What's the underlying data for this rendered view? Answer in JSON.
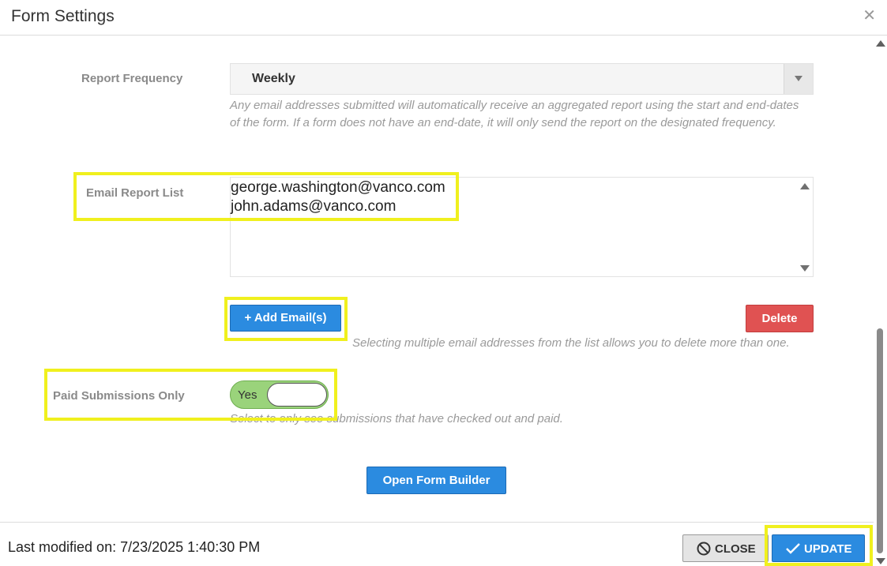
{
  "dialog": {
    "title": "Form Settings",
    "close_glyph": "✕"
  },
  "report_frequency": {
    "label": "Report Frequency",
    "value": "Weekly",
    "help": "Any email addresses submitted will automatically receive an aggregated report using the start and end-dates of the form. If a form does not have an end-date, it will only send the report on the designated frequency."
  },
  "email_report_list": {
    "label": "Email Report List",
    "items": [
      "george.washington@vanco.com",
      "john.adams@vanco.com"
    ]
  },
  "email_actions": {
    "add_label": "+ Add Email(s)",
    "delete_label": "Delete",
    "help": "Selecting multiple email addresses from the list allows you to delete more than one."
  },
  "paid_submissions": {
    "label": "Paid Submissions Only",
    "toggle_text": "Yes",
    "enabled": true,
    "help": "Select to only see submissions that have checked out and paid."
  },
  "form_builder": {
    "label": "Open Form Builder"
  },
  "footer": {
    "last_modified": "Last modified on: 7/23/2025 1:40:30 PM",
    "close_label": "CLOSE",
    "update_label": "UPDATE"
  },
  "icons": {
    "close_x": "close-icon",
    "close_button": "ban-icon",
    "update_button": "check-icon"
  },
  "colors": {
    "accent_blue": "#2b8be0",
    "delete_red": "#e05252",
    "toggle_green": "#9ad37b",
    "highlight_yellow": "#f0f01e"
  }
}
